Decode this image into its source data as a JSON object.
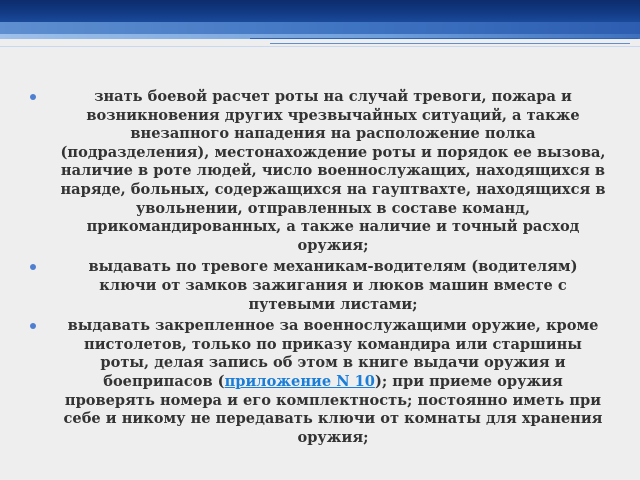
{
  "colors": {
    "background": "#eeeeee",
    "header_dark": "#123b86",
    "header_mid": "#3f74c2",
    "bullet": "#4f7fd0",
    "text": "#333333",
    "link": "#1a7dd8"
  },
  "list": {
    "items": [
      {
        "text": "знать боевой расчет роты на случай тревоги, пожара и возникновения других чрезвычайных ситуаций, а также внезапного нападения на расположение полка (подразделения), местонахождение роты и порядок ее вызова, наличие в роте людей, число военнослужащих, находящихся в наряде, больных, содержащихся на гауптвахте, находящихся в увольнении, отправленных в составе команд, прикомандированных, а также наличие и точный расход оружия;"
      },
      {
        "text": "выдавать по тревоге механикам-водителям (водителям) ключи от замков зажигания и люков машин вместе с путевыми листами;"
      },
      {
        "text_before": "выдавать закрепленное за военнослужащими оружие, кроме пистолетов, только по приказу командира или старшины роты, делая запись об этом в книге выдачи оружия и боеприпасов (",
        "link_text": "приложение N 10",
        "text_after": "); при приеме оружия проверять номера и его комплектность; постоянно иметь при себе и никому не передавать ключи от комнаты для хранения оружия;"
      }
    ]
  }
}
